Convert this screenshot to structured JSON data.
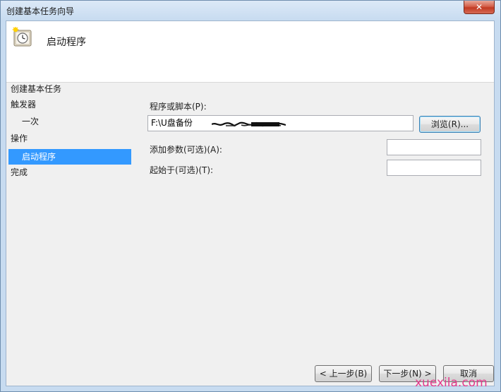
{
  "window": {
    "title": "创建基本任务向导",
    "close_glyph": "✕"
  },
  "header": {
    "title": "启动程序",
    "icon": "task-clock-icon"
  },
  "nav": {
    "heading": "创建基本任务",
    "items": [
      {
        "label": "触发器",
        "selected": false,
        "sub": false
      },
      {
        "label": "一次",
        "selected": false,
        "sub": true
      },
      {
        "label": "操作",
        "selected": false,
        "sub": false
      },
      {
        "label": "启动程序",
        "selected": true,
        "sub": true
      },
      {
        "label": "完成",
        "selected": false,
        "sub": false
      }
    ]
  },
  "form": {
    "program_label": "程序或脚本(P):",
    "program_value": "F:\\U盘备份",
    "browse_label": "浏览(R)...",
    "args_label": "添加参数(可选)(A):",
    "args_value": "",
    "start_label": "起始于(可选)(T):",
    "start_value": ""
  },
  "footer": {
    "back_label": "< 上一步(B)",
    "next_label": "下一步(N) >",
    "cancel_label": "取消"
  },
  "watermark": "xuexila.com",
  "colors": {
    "selection": "#3399ff",
    "watermark": "#e33a8c"
  }
}
